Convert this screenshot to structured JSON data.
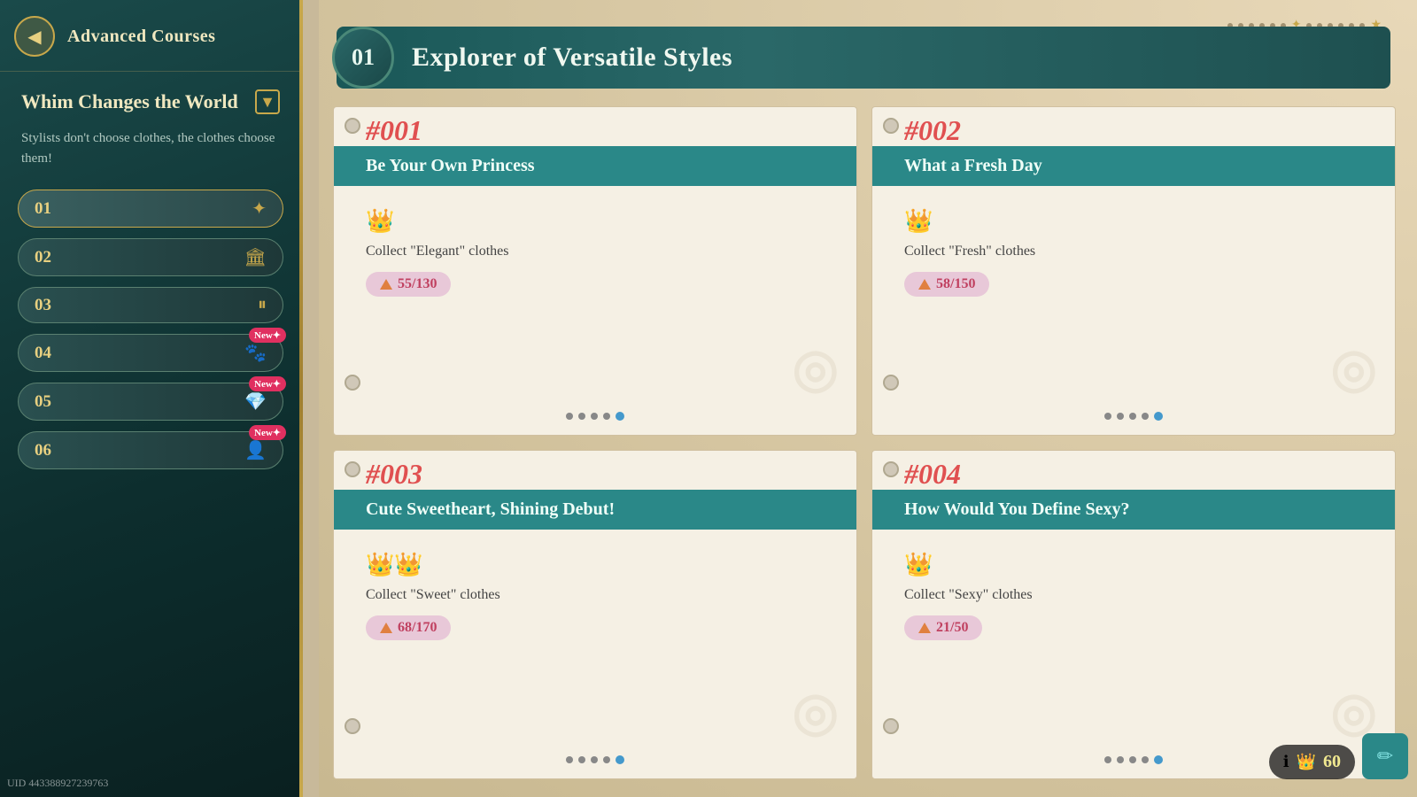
{
  "sidebar": {
    "back_button_icon": "◀",
    "title": "Advanced Courses",
    "category": {
      "name": "Whim Changes the World",
      "description": "Stylists don't choose clothes, the clothes choose them!"
    },
    "chapters": [
      {
        "num": "01",
        "icon": "✦",
        "active": true,
        "new_badge": null
      },
      {
        "num": "02",
        "icon": "🏛",
        "active": false,
        "new_badge": null
      },
      {
        "num": "03",
        "icon": "⏸",
        "active": false,
        "new_badge": null
      },
      {
        "num": "04",
        "icon": "🐾",
        "active": false,
        "new_badge": "New"
      },
      {
        "num": "05",
        "icon": "💎",
        "active": false,
        "new_badge": "New"
      },
      {
        "num": "06",
        "icon": "👤",
        "active": false,
        "new_badge": "New"
      }
    ]
  },
  "main": {
    "section_num": "01",
    "section_title": "Explorer of Versatile Styles",
    "cards": [
      {
        "number": "#001",
        "title": "Be Your Own Princess",
        "crowns": "👑",
        "requirement": "Collect \"Elegant\" clothes",
        "progress": "55/130",
        "dots": [
          false,
          false,
          false,
          false,
          true
        ],
        "watermark": "◎"
      },
      {
        "number": "#002",
        "title": "What a Fresh Day",
        "crowns": "👑",
        "requirement": "Collect \"Fresh\" clothes",
        "progress": "58/150",
        "dots": [
          false,
          false,
          false,
          false,
          true
        ],
        "watermark": "◎"
      },
      {
        "number": "#003",
        "title": "Cute Sweetheart, Shining Debut!",
        "crowns": "👑👑",
        "requirement": "Collect \"Sweet\" clothes",
        "progress": "68/170",
        "dots": [
          false,
          false,
          false,
          false,
          true
        ],
        "watermark": "◎"
      },
      {
        "number": "#004",
        "title": "How Would You Define Sexy?",
        "crowns": "👑",
        "requirement": "Collect \"Sexy\" clothes",
        "progress": "21/50",
        "dots": [
          false,
          false,
          false,
          false,
          true
        ],
        "watermark": "◎"
      }
    ]
  },
  "bottom": {
    "uid": "UID 443388927239763",
    "currency_amount": "60",
    "currency_icon": "👑",
    "info_icon": "ℹ"
  }
}
